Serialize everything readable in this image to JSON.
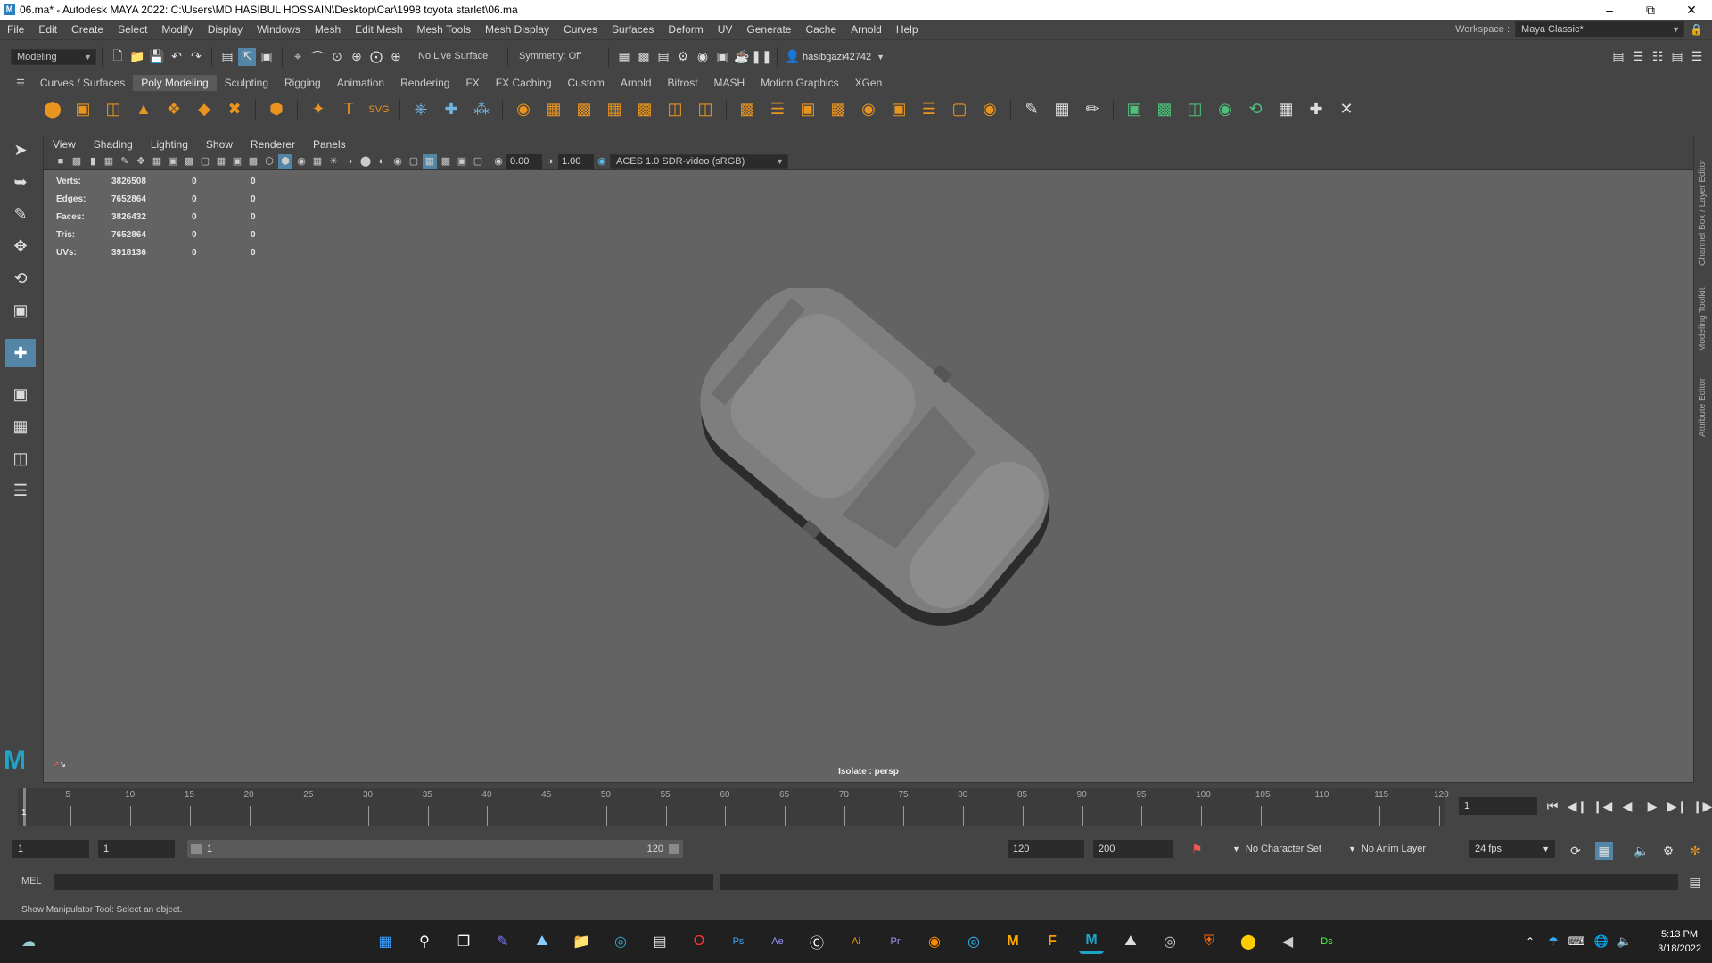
{
  "window": {
    "title": "06.ma* - Autodesk MAYA 2022: C:\\Users\\MD HASIBUL HOSSAIN\\Desktop\\Car\\1998 toyota starlet\\06.ma"
  },
  "menus": [
    "File",
    "Edit",
    "Create",
    "Select",
    "Modify",
    "Display",
    "Windows",
    "Mesh",
    "Edit Mesh",
    "Mesh Tools",
    "Mesh Display",
    "Curves",
    "Surfaces",
    "Deform",
    "UV",
    "Generate",
    "Cache",
    "Arnold",
    "Help"
  ],
  "workspace": {
    "label": "Workspace :",
    "value": "Maya Classic*"
  },
  "statusline": {
    "mode": "Modeling",
    "live_surface": "No Live Surface",
    "symmetry": "Symmetry: Off",
    "user": "hasibgazi42742"
  },
  "shelf_tabs": [
    "Curves / Surfaces",
    "Poly Modeling",
    "Sculpting",
    "Rigging",
    "Animation",
    "Rendering",
    "FX",
    "FX Caching",
    "Custom",
    "Arnold",
    "Bifrost",
    "MASH",
    "Motion Graphics",
    "XGen"
  ],
  "active_shelf": "Poly Modeling",
  "viewport": {
    "menus": [
      "View",
      "Shading",
      "Lighting",
      "Show",
      "Renderer",
      "Panels"
    ],
    "exposure": "0.00",
    "gamma": "1.00",
    "colorspace": "ACES 1.0 SDR-video (sRGB)",
    "label": "Isolate : persp",
    "hud": [
      {
        "label": "Verts:",
        "v1": "3826508",
        "v2": "0",
        "v3": "0"
      },
      {
        "label": "Edges:",
        "v1": "7652864",
        "v2": "0",
        "v3": "0"
      },
      {
        "label": "Faces:",
        "v1": "3826432",
        "v2": "0",
        "v3": "0"
      },
      {
        "label": "Tris:",
        "v1": "7652864",
        "v2": "0",
        "v3": "0"
      },
      {
        "label": "UVs:",
        "v1": "3918136",
        "v2": "0",
        "v3": "0"
      }
    ]
  },
  "right_panels": [
    "Channel Box / Layer Editor",
    "Modeling Toolkit",
    "Attribute Editor"
  ],
  "timeline": {
    "ticks": [
      "1",
      "5",
      "10",
      "15",
      "20",
      "25",
      "30",
      "35",
      "40",
      "45",
      "50",
      "55",
      "60",
      "65",
      "70",
      "75",
      "80",
      "85",
      "90",
      "95",
      "100",
      "105",
      "110",
      "115",
      "120"
    ],
    "current_frame": "1"
  },
  "range": {
    "start": "1",
    "playback_start": "1",
    "slider_start": "1",
    "slider_end": "120",
    "playback_end": "120",
    "end": "200",
    "character_set": "No Character Set",
    "anim_layer": "No Anim Layer",
    "fps": "24 fps"
  },
  "cmdline": {
    "label": "MEL"
  },
  "helpline": "Show Manipulator Tool: Select an object.",
  "clock": {
    "time": "5:13 PM",
    "date": "3/18/2022"
  }
}
